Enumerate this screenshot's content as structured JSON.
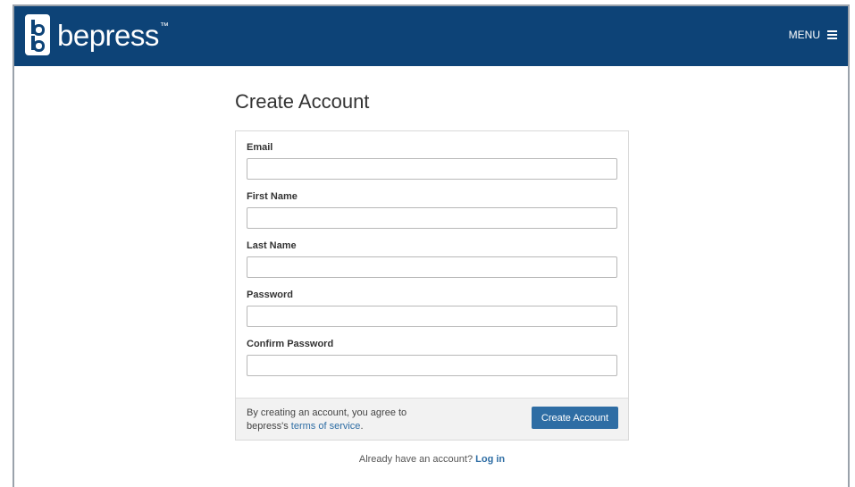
{
  "header": {
    "logo_text": "bepress",
    "logo_tm": "™",
    "menu_label": "MENU",
    "bar_color": "#0d4377",
    "logo_icon": "bepress-mark-icon",
    "menu_icon": "hamburger-icon"
  },
  "page": {
    "title": "Create Account"
  },
  "form": {
    "fields": [
      {
        "label": "Email",
        "value": "",
        "placeholder": ""
      },
      {
        "label": "First Name",
        "value": "",
        "placeholder": ""
      },
      {
        "label": "Last Name",
        "value": "",
        "placeholder": ""
      },
      {
        "label": "Password",
        "value": "",
        "placeholder": ""
      },
      {
        "label": "Confirm Password",
        "value": "",
        "placeholder": ""
      }
    ],
    "terms_prefix": "By creating an account, you agree to",
    "terms_middle": "bepress's",
    "terms_link": "terms of service",
    "terms_suffix": ".",
    "submit_label": "Create Account",
    "button_color": "#2e6da4"
  },
  "footer": {
    "prompt": "Already have an account?",
    "login_link": "Log in"
  }
}
